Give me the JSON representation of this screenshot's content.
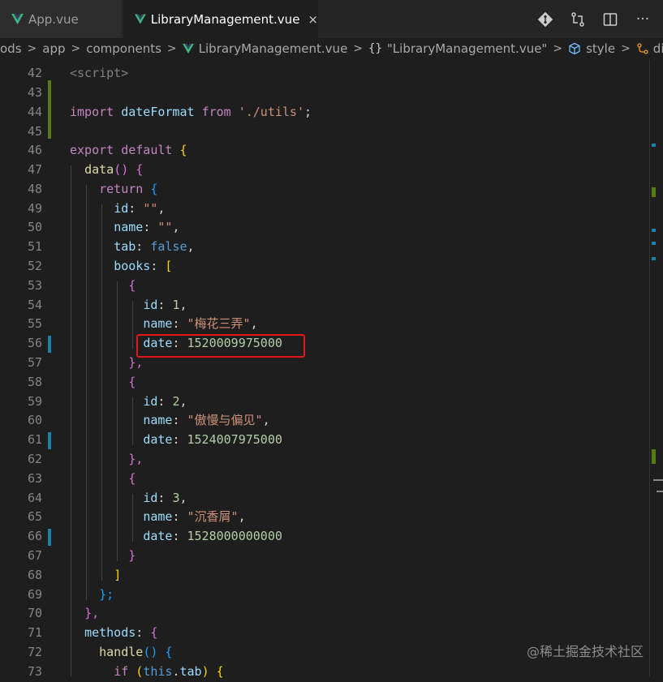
{
  "tabs": [
    {
      "label": "App.vue",
      "active": false
    },
    {
      "label": "LibraryManagement.vue",
      "active": true,
      "close": "×"
    }
  ],
  "actions": [
    "git-icon",
    "compare-changes-icon",
    "split-editor-icon",
    "more-actions-icon"
  ],
  "more_label": "···",
  "breadcrumb": {
    "items": [
      "ods",
      "app",
      "components",
      "LibraryManagement.vue",
      "\"LibraryManagement.vue\"",
      "style",
      "div.bool"
    ],
    "sep": ">",
    "obj_symbol": "{}"
  },
  "line_numbers": [
    "42",
    "43",
    "44",
    "45",
    "46",
    "47",
    "48",
    "49",
    "50",
    "51",
    "52",
    "53",
    "54",
    "55",
    "56",
    "57",
    "58",
    "59",
    "60",
    "61",
    "62",
    "63",
    "64",
    "65",
    "66",
    "67",
    "68",
    "69",
    "70",
    "71",
    "72",
    "73"
  ],
  "code": {
    "l42": "<script>",
    "l44_import": "import",
    "l44_name": "dateFormat",
    "l44_from": "from",
    "l44_path": "'./utils'",
    "l44_end": ";",
    "l46_export": "export",
    "l46_default": "default",
    "l46_brace": "{",
    "l47_fn": "data",
    "l47_paren": "()",
    "l47_brace": "{",
    "l48_return": "return",
    "l48_brace": "{",
    "l49_key": "id",
    "l49_val": "\"\"",
    "l50_key": "name",
    "l50_val": "\"\"",
    "l51_key": "tab",
    "l51_val": "false",
    "l52_key": "books",
    "l52_bracket": "[",
    "open_brace": "{",
    "close_brace_comma": "},",
    "close_brace": "}",
    "id_key": "id",
    "name_key": "name",
    "date_key": "date",
    "colon": ":",
    "comma": ",",
    "book1": {
      "id": "1",
      "name": "\"梅花三弄\"",
      "date": "1520009975000"
    },
    "book2": {
      "id": "2",
      "name": "\"傲慢与偏见\"",
      "date": "1524007975000"
    },
    "book3": {
      "id": "3",
      "name": "\"沉香屑\"",
      "date": "1528000000000"
    },
    "l68_bracket": "]",
    "l69_end": "};",
    "l70_end": "},",
    "l71_key": "methods",
    "l71_brace": "{",
    "l72_fn": "handle",
    "l72_paren": "()",
    "l72_brace": "{",
    "l73_if": "if",
    "l73_paren_open": "(",
    "l73_this": "this",
    "l73_dot": ".",
    "l73_tab": "tab",
    "l73_paren_close": ")",
    "l73_brace": "{"
  },
  "watermark": "@稀土掘金技术社区",
  "colors": {
    "highlight_box": "#e5171b",
    "git_added": "#587c0c",
    "git_modified": "#1b81a8",
    "vue_green": "#41b883"
  }
}
